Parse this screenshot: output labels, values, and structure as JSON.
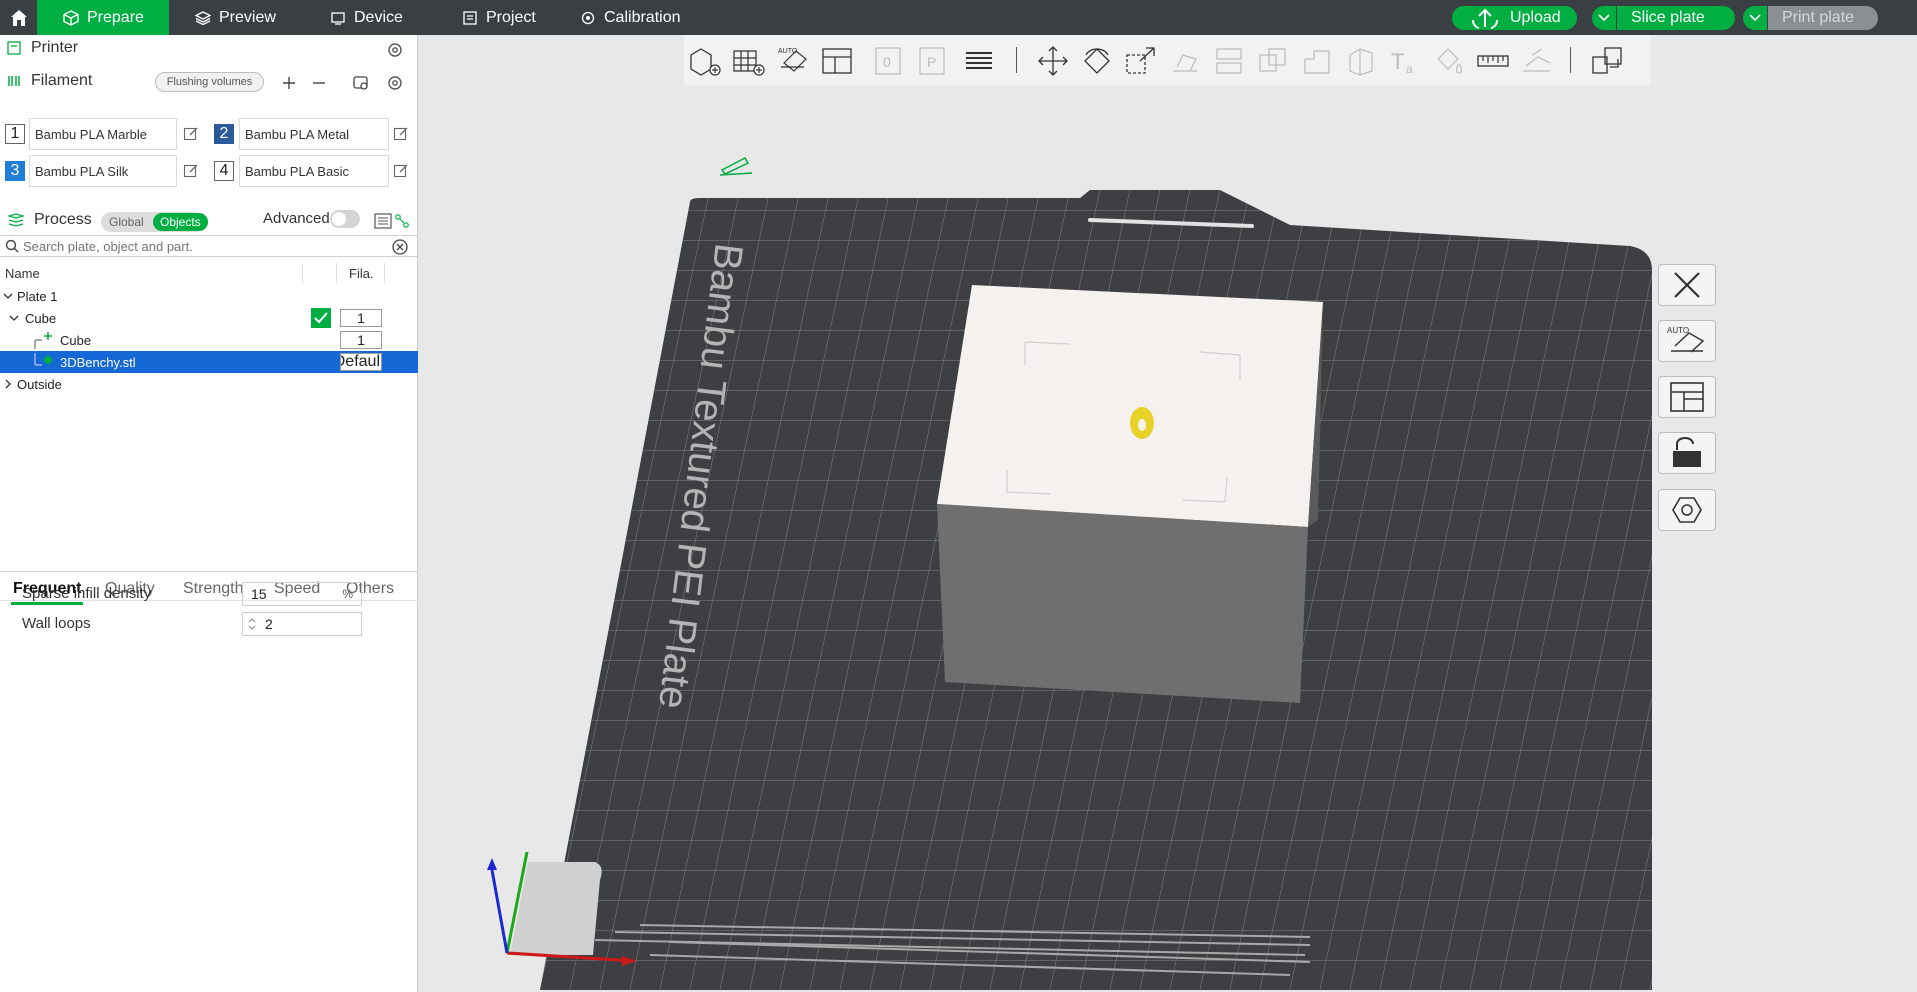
{
  "topbar": {
    "tabs": [
      {
        "label": "Prepare",
        "icon": "cube-icon",
        "active": true
      },
      {
        "label": "Preview",
        "icon": "layers-icon",
        "active": false
      },
      {
        "label": "Device",
        "icon": "device-icon",
        "active": false
      },
      {
        "label": "Project",
        "icon": "project-icon",
        "active": false
      },
      {
        "label": "Calibration",
        "icon": "calibration-icon",
        "active": false
      }
    ],
    "upload_label": "Upload",
    "slice_label": "Slice plate",
    "print_label": "Print plate",
    "accent_color": "#00ae42",
    "bar_color": "#3a3f44"
  },
  "sidebar": {
    "printer_title": "Printer",
    "filament_title": "Filament",
    "flushing_label": "Flushing volumes",
    "filaments": [
      {
        "num": "1",
        "name": "Bambu PLA Marble",
        "color": "#ffffff"
      },
      {
        "num": "2",
        "name": "Bambu PLA Metal",
        "color": "#2d5a9a"
      },
      {
        "num": "3",
        "name": "Bambu PLA Silk",
        "color": "#1f7fd6"
      },
      {
        "num": "4",
        "name": "Bambu PLA Basic",
        "color": "#ffffff"
      }
    ],
    "process_title": "Process",
    "toggle_global": "Global",
    "toggle_objects": "Objects",
    "advanced_label": "Advanced",
    "search_placeholder": "Search plate, object and part.",
    "tree": {
      "col_name": "Name",
      "col_fila": "Fila.",
      "rows": [
        {
          "label": "Plate 1",
          "fila": ""
        },
        {
          "label": "Cube",
          "fila": "1"
        },
        {
          "label": "Cube",
          "fila": "1"
        },
        {
          "label": "3DBenchy.stl",
          "fila": "Defaul"
        },
        {
          "label": "Outside",
          "fila": ""
        }
      ]
    },
    "param_tabs": [
      "Frequent",
      "Quality",
      "Strength",
      "Speed",
      "Others"
    ],
    "params": [
      {
        "label": "Sparse infill density",
        "value": "15",
        "unit": "%"
      },
      {
        "label": "Wall loops",
        "value": "2",
        "unit": ""
      }
    ]
  },
  "viewport": {
    "plate_text": "Bambu Textured PEI Plate"
  }
}
